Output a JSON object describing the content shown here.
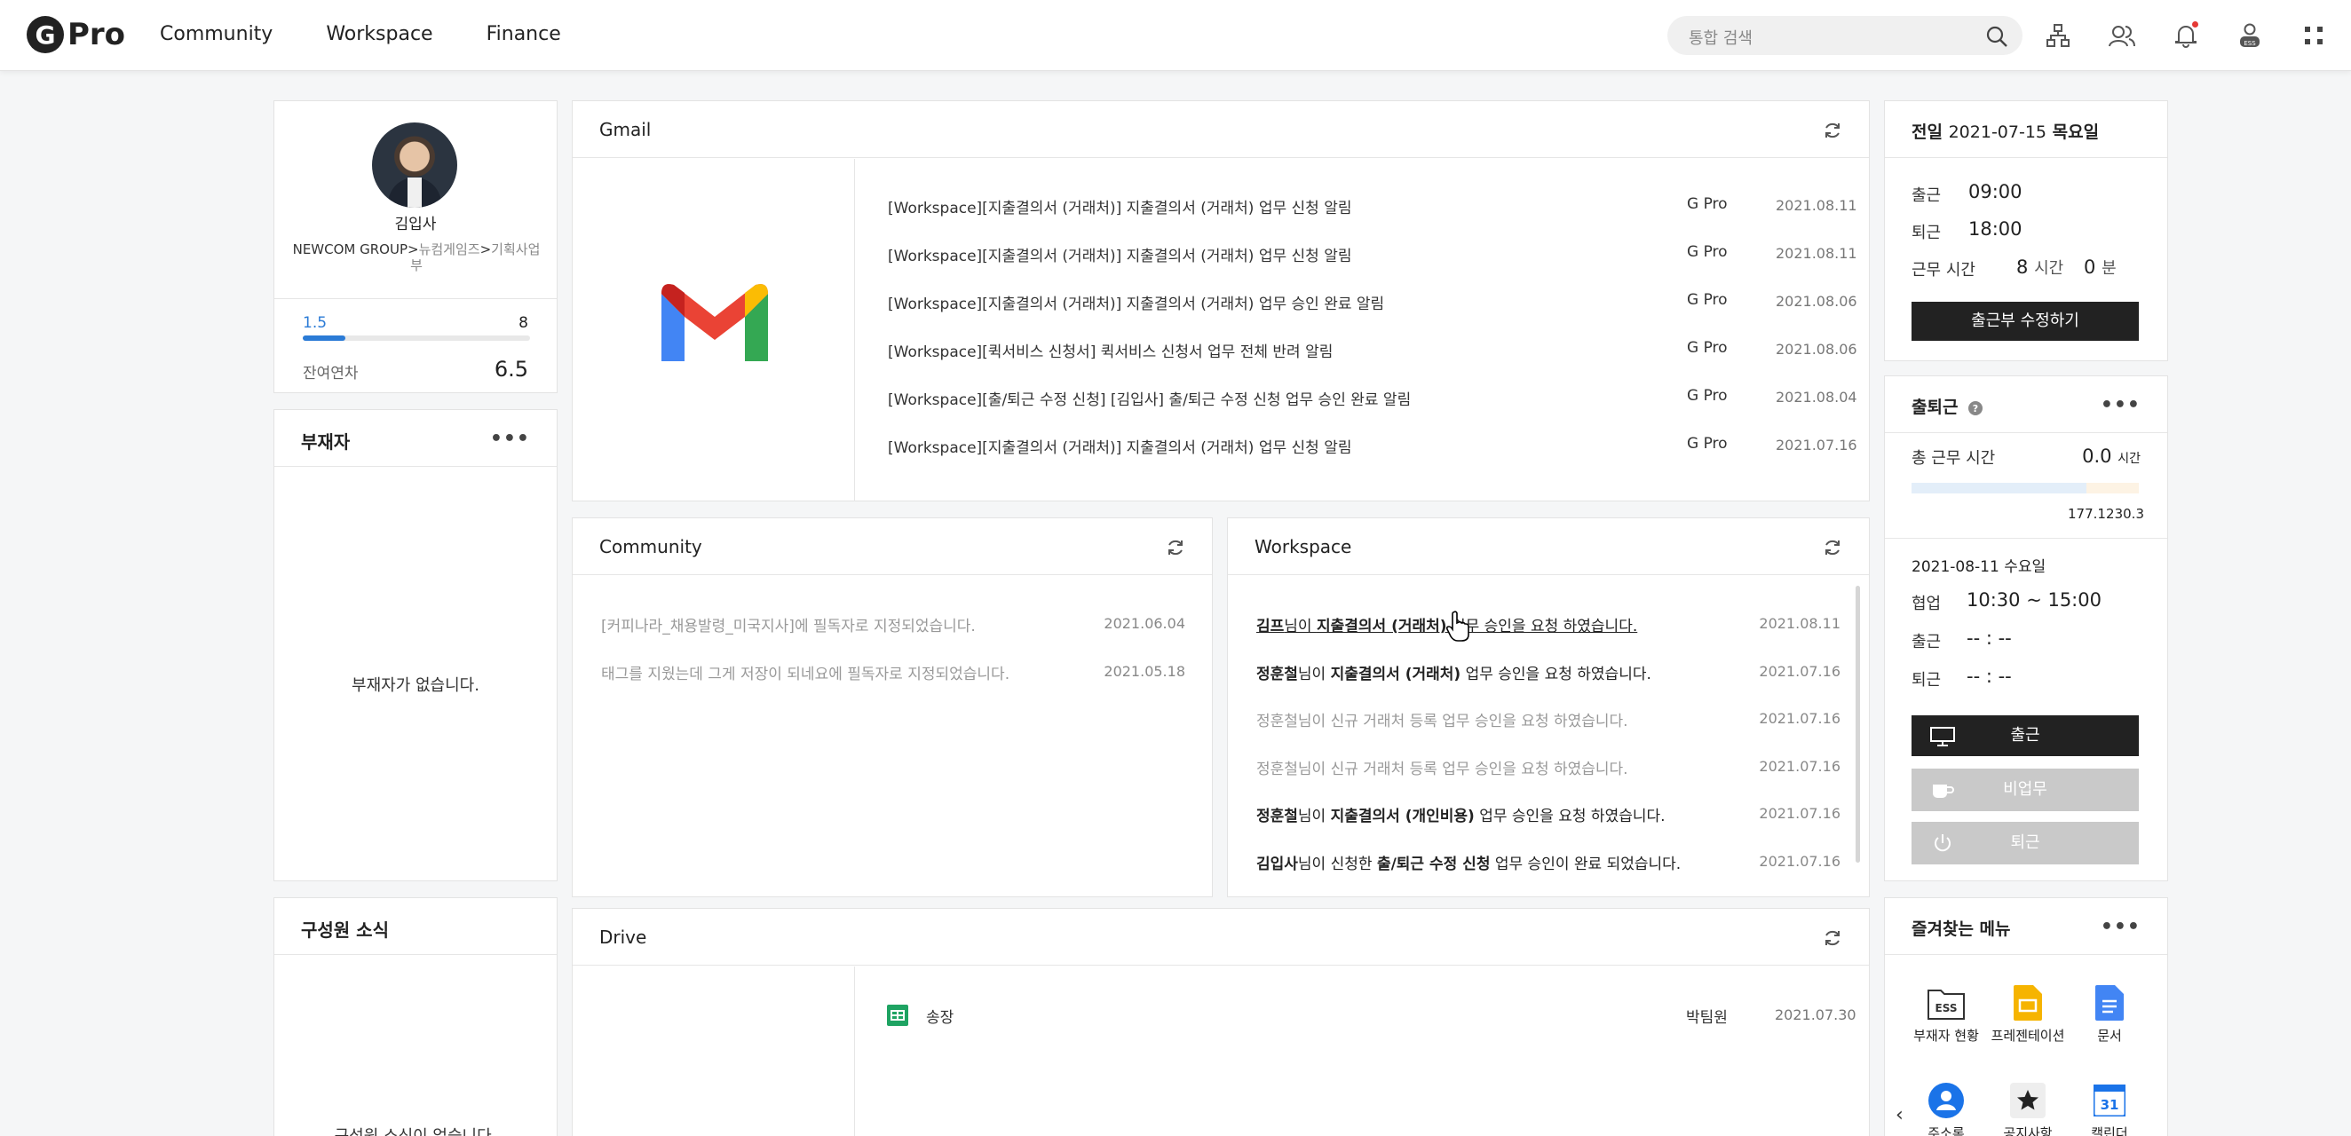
{
  "app": {
    "logo_letter": "G",
    "logo_text": "Pro"
  },
  "nav": [
    "Community",
    "Workspace",
    "Finance"
  ],
  "search": {
    "placeholder": "통합 검색"
  },
  "profile": {
    "name": "김입사",
    "org_main": "NEWCOM GROUP>",
    "org_sub": "뉴컴게임즈",
    "org_sep": ">",
    "org_dept": "기획사업부",
    "leave_used": "1.5",
    "leave_total": "8",
    "leave_used_fraction": 0.1875,
    "leave_remain_label": "잔여연차",
    "leave_remain": "6.5"
  },
  "absentee": {
    "title": "부재자",
    "empty": "부재자가 없습니다."
  },
  "member_news": {
    "title": "구성원 소식",
    "empty": "구성원 소식이 없습니다."
  },
  "gmail": {
    "title": "Gmail",
    "rows": [
      {
        "subject": "[Workspace][지출결의서 (거래처)] 지출결의서 (거래처) 업무 신청 알림",
        "from": "G Pro",
        "date": "2021.08.11"
      },
      {
        "subject": "[Workspace][지출결의서 (거래처)] 지출결의서 (거래처) 업무 신청 알림",
        "from": "G Pro",
        "date": "2021.08.11"
      },
      {
        "subject": "[Workspace][지출결의서 (거래처)] 지출결의서 (거래처) 업무 승인 완료 알림",
        "from": "G Pro",
        "date": "2021.08.06"
      },
      {
        "subject": "[Workspace][퀵서비스 신청서] 퀵서비스 신청서 업무 전체 반려 알림",
        "from": "G Pro",
        "date": "2021.08.06"
      },
      {
        "subject": "[Workspace][출/퇴근 수정 신청] [김입사] 출/퇴근 수정 신청 업무 승인 완료 알림",
        "from": "G Pro",
        "date": "2021.08.04"
      },
      {
        "subject": "[Workspace][지출결의서 (거래처)] 지출결의서 (거래처) 업무 신청 알림",
        "from": "G Pro",
        "date": "2021.07.16"
      }
    ]
  },
  "community": {
    "title": "Community",
    "rows": [
      {
        "text": "[커피나라_채용발령_미국지사]에 필독자로 지정되었습니다.",
        "date": "2021.06.04"
      },
      {
        "text": "태그를 지웠는데 그게 저장이 되네요에 필독자로 지정되었습니다.",
        "date": "2021.05.18"
      }
    ]
  },
  "workspace": {
    "title": "Workspace",
    "rows": [
      {
        "name": "김프",
        "mid": "님이 ",
        "doc": "지출결의서 (거래처)",
        "rest": " 업무 승인을 요청 하였습니다.",
        "date": "2021.08.11"
      },
      {
        "name": "정훈철",
        "mid": "님이 ",
        "doc": "지출결의서 (거래처)",
        "rest": " 업무 승인을 요청 하였습니다.",
        "date": "2021.07.16"
      },
      {
        "name": "정훈철님이 신규 거래처 등록 업무 승인을 요청 하였습니다.",
        "mid": "",
        "doc": "",
        "rest": "",
        "date": "2021.07.16"
      },
      {
        "name": "정훈철님이 신규 거래처 등록 업무 승인을 요청 하였습니다.",
        "mid": "",
        "doc": "",
        "rest": "",
        "date": "2021.07.16"
      },
      {
        "name": "정훈철",
        "mid": "님이 ",
        "doc": "지출결의서 (개인비용)",
        "rest": " 업무 승인을 요청 하였습니다.",
        "date": "2021.07.16"
      },
      {
        "name": "김입사",
        "mid": "님이 신청한 ",
        "doc": "출/퇴근 수정 신청",
        "rest": " 업무 승인이 완료 되었습니다.",
        "date": "2021.07.16"
      }
    ]
  },
  "drive": {
    "title": "Drive",
    "rows": [
      {
        "name": "송장",
        "owner": "박팀원",
        "date": "2021.07.30"
      }
    ]
  },
  "yesterday": {
    "label": "전일",
    "date": "2021-07-15",
    "weekday": "목요일",
    "in_label": "출근",
    "in_value": "09:00",
    "out_label": "퇴근",
    "out_value": "18:00",
    "work_label": "근무 시간",
    "work_hours": "8",
    "hours_unit": "시간",
    "work_min": "0",
    "min_unit": "분",
    "edit_button": "출근부 수정하기"
  },
  "attendance": {
    "title": "출퇴근",
    "total_label": "총 근무 시간",
    "total_value": "0.0",
    "total_unit": "시간",
    "bar_mark1": "177.1",
    "bar_mark2": "230.3",
    "bar_fraction": 0.77,
    "today_date": "2021-08-11 수요일",
    "coop_label": "협업",
    "coop_value": "10:30 ~ 15:00",
    "in_label": "출근",
    "in_value": "-- : --",
    "out_label": "퇴근",
    "out_value": "-- : --",
    "btn_in": "출근",
    "btn_away": "비업무",
    "btn_out": "퇴근"
  },
  "favorites": {
    "title": "즐겨찾는 메뉴",
    "items": [
      {
        "label": "부재자 현황",
        "icon": "ess-folder-icon"
      },
      {
        "label": "프레젠테이션",
        "icon": "slides-icon"
      },
      {
        "label": "문서",
        "icon": "docs-icon"
      },
      {
        "label": "주소록",
        "icon": "contacts-icon"
      },
      {
        "label": "공지사항",
        "icon": "star-icon"
      },
      {
        "label": "캘린더",
        "icon": "calendar-icon"
      }
    ],
    "calendar_day": "31",
    "ess_badge": "ESS"
  },
  "colors": {
    "accent": "#2b7bd6",
    "dark_button": "#222222",
    "disabled_button": "#c9c9c9"
  }
}
